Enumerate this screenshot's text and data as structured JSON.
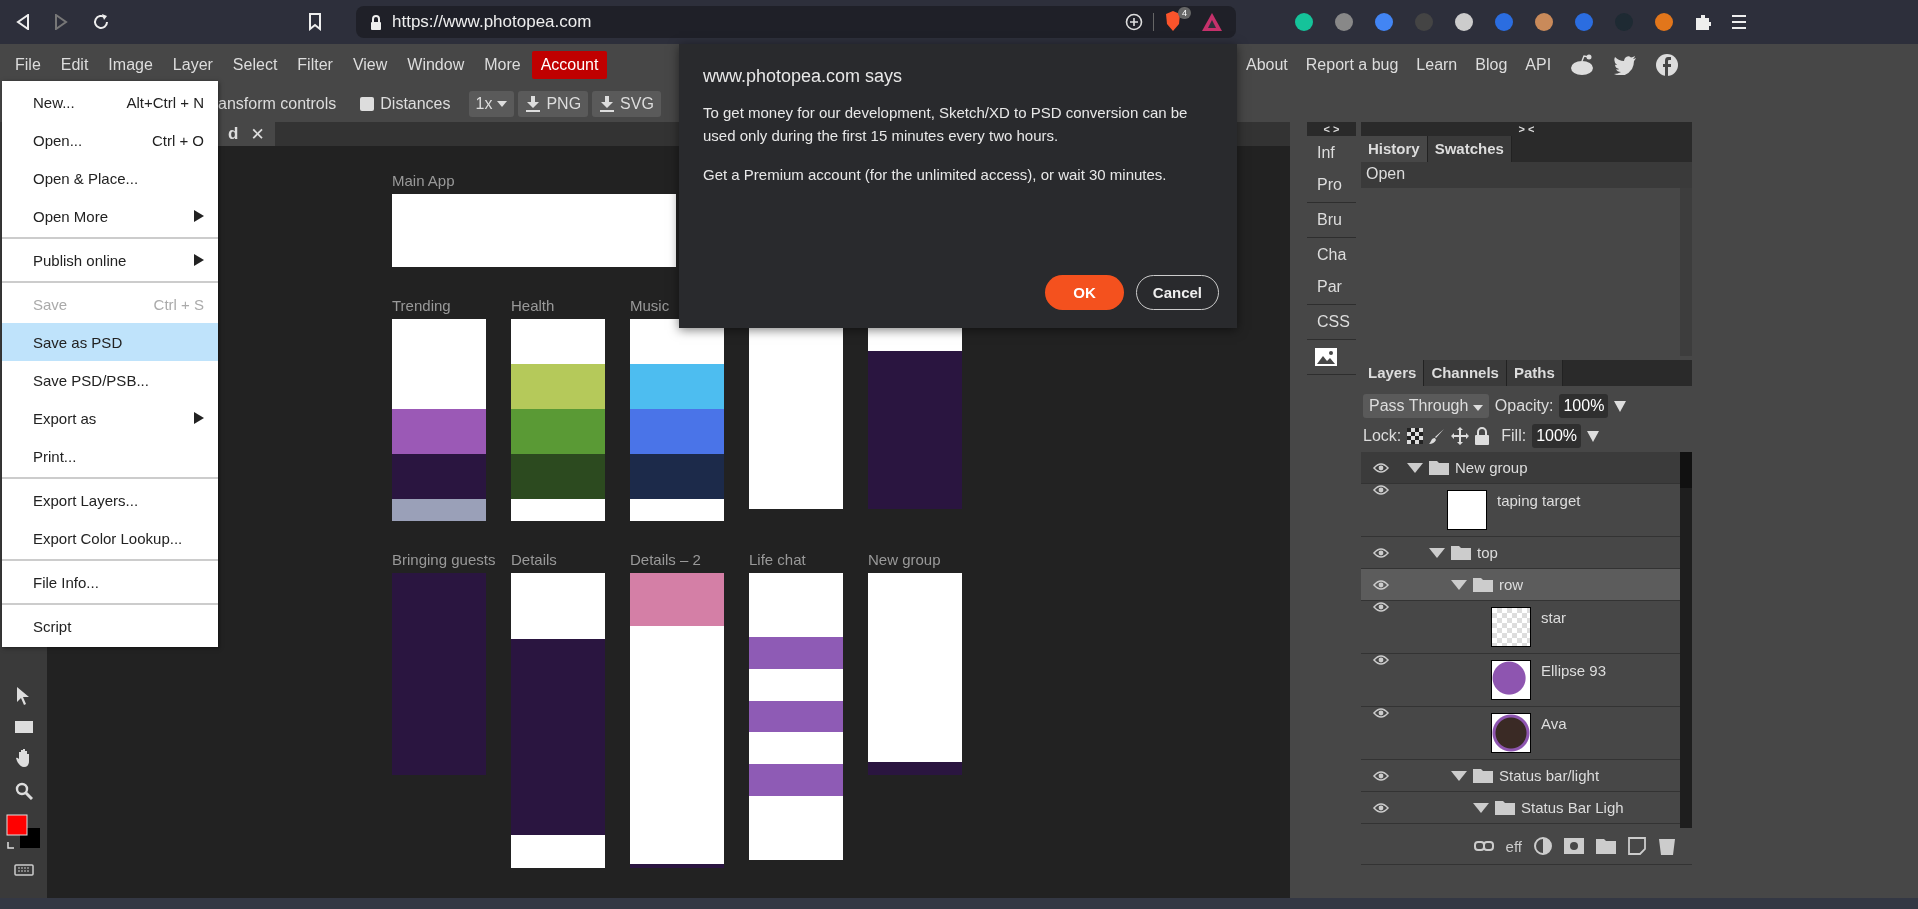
{
  "browser": {
    "url": "https://www.photopea.com",
    "shield_count": "4"
  },
  "menu_bar": {
    "items": [
      {
        "label": "File",
        "highlighted": false
      },
      {
        "label": "Edit",
        "highlighted": false
      },
      {
        "label": "Image",
        "highlighted": false
      },
      {
        "label": "Layer",
        "highlighted": false
      },
      {
        "label": "Select",
        "highlighted": false
      },
      {
        "label": "Filter",
        "highlighted": false
      },
      {
        "label": "View",
        "highlighted": false
      },
      {
        "label": "Window",
        "highlighted": false
      },
      {
        "label": "More",
        "highlighted": false
      },
      {
        "label": "Account",
        "highlighted": true
      }
    ],
    "links": [
      "About",
      "Report a bug",
      "Learn",
      "Blog",
      "API"
    ]
  },
  "options_bar": {
    "transform_label": "ansform controls",
    "distances": {
      "label": "Distances",
      "checked": false
    },
    "scale": "1x",
    "export_buttons": [
      "PNG",
      "SVG"
    ]
  },
  "document_tab": {
    "label": "d",
    "close": "✕"
  },
  "file_menu": {
    "sections": [
      [
        {
          "label": "New...",
          "shortcut": "Alt+Ctrl + N",
          "submenu": false,
          "disabled": false,
          "selected": false
        },
        {
          "label": "Open...",
          "shortcut": "Ctrl + O",
          "submenu": false,
          "disabled": false,
          "selected": false
        },
        {
          "label": "Open & Place...",
          "submenu": false,
          "disabled": false,
          "selected": false
        },
        {
          "label": "Open More",
          "submenu": true,
          "disabled": false,
          "selected": false
        }
      ],
      [
        {
          "label": "Publish online",
          "submenu": true,
          "disabled": false,
          "selected": false
        }
      ],
      [
        {
          "label": "Save",
          "shortcut": "Ctrl + S",
          "submenu": false,
          "disabled": true,
          "selected": false
        },
        {
          "label": "Save as PSD",
          "submenu": false,
          "disabled": false,
          "selected": true
        },
        {
          "label": "Save PSD/PSB...",
          "submenu": false,
          "disabled": false,
          "selected": false
        },
        {
          "label": "Export as",
          "submenu": true,
          "disabled": false,
          "selected": false
        },
        {
          "label": "Print...",
          "submenu": false,
          "disabled": false,
          "selected": false
        }
      ],
      [
        {
          "label": "Export Layers...",
          "submenu": false,
          "disabled": false,
          "selected": false
        },
        {
          "label": "Export Color Lookup...",
          "submenu": false,
          "disabled": false,
          "selected": false
        }
      ],
      [
        {
          "label": "File Info...",
          "submenu": false,
          "disabled": false,
          "selected": false
        }
      ],
      [
        {
          "label": "Script",
          "submenu": false,
          "disabled": false,
          "selected": false
        }
      ]
    ]
  },
  "canvas": {
    "main_artboard": {
      "label": "Main App",
      "kind": "blank"
    },
    "rows": [
      [
        {
          "label": "Trending",
          "kind": "feed-purple"
        },
        {
          "label": "Health",
          "kind": "feed-green"
        },
        {
          "label": "Music",
          "kind": "feed-blue"
        },
        {
          "kind": "nav"
        },
        {
          "kind": "dark-list"
        }
      ],
      [
        {
          "label": "Bringing guests",
          "kind": "dark"
        },
        {
          "label": "Details",
          "kind": "details"
        },
        {
          "label": "Details – 2",
          "kind": "pink-detail"
        },
        {
          "label": "Life chat",
          "kind": "chat"
        },
        {
          "label": "New group",
          "kind": "form"
        }
      ]
    ]
  },
  "dialog": {
    "title": "www.photopea.com says",
    "paragraphs": [
      "To get money for our development, Sketch/XD to PSD conversion can be used only during the first 15 minutes every two hours.",
      "Get a Premium account (for the unlimited access), or wait 30 minutes."
    ],
    "ok": "OK",
    "cancel": "Cancel"
  },
  "side_strip": {
    "toggle": "< >",
    "groups": [
      [
        "Inf",
        "Pro"
      ],
      [
        "Bru"
      ],
      [
        "Cha",
        "Par"
      ],
      [
        "CSS"
      ]
    ]
  },
  "panel": {
    "toggle": "> <",
    "top_tabs": [
      {
        "label": "History",
        "selected": true
      },
      {
        "label": "Swatches",
        "selected": false
      }
    ],
    "history": [
      "Open"
    ],
    "layer_tabs": [
      {
        "label": "Layers",
        "selected": true
      },
      {
        "label": "Channels",
        "selected": false
      },
      {
        "label": "Paths",
        "selected": false
      }
    ],
    "blend_mode": "Pass Through",
    "opacity_label": "Opacity:",
    "opacity": "100%",
    "lock_label": "Lock:",
    "fill_label": "Fill:",
    "fill": "100%",
    "footer_label": "eff",
    "layers": [
      {
        "name": "New group",
        "kind": "group",
        "expanded": true,
        "visible": true,
        "selected": false,
        "children": [
          {
            "name": "taping target",
            "kind": "white",
            "visible": true,
            "selected": false
          },
          {
            "name": "top",
            "kind": "group",
            "expanded": true,
            "visible": true,
            "selected": false,
            "children": [
              {
                "name": "row",
                "kind": "group",
                "expanded": true,
                "visible": true,
                "selected": true,
                "children": [
                  {
                    "name": "star",
                    "kind": "transparent",
                    "visible": true,
                    "selected": false
                  },
                  {
                    "name": "Ellipse 93",
                    "kind": "ellipse",
                    "visible": true,
                    "selected": false
                  },
                  {
                    "name": "Ava",
                    "kind": "photo",
                    "visible": true,
                    "selected": false
                  }
                ]
              },
              {
                "name": "Status bar/light",
                "kind": "group",
                "expanded": true,
                "visible": true,
                "selected": false,
                "children": [
                  {
                    "name": "Status Bar Ligh",
                    "kind": "group",
                    "expanded": true,
                    "visible": true,
                    "selected": false
                  }
                ]
              }
            ]
          }
        ]
      }
    ]
  }
}
